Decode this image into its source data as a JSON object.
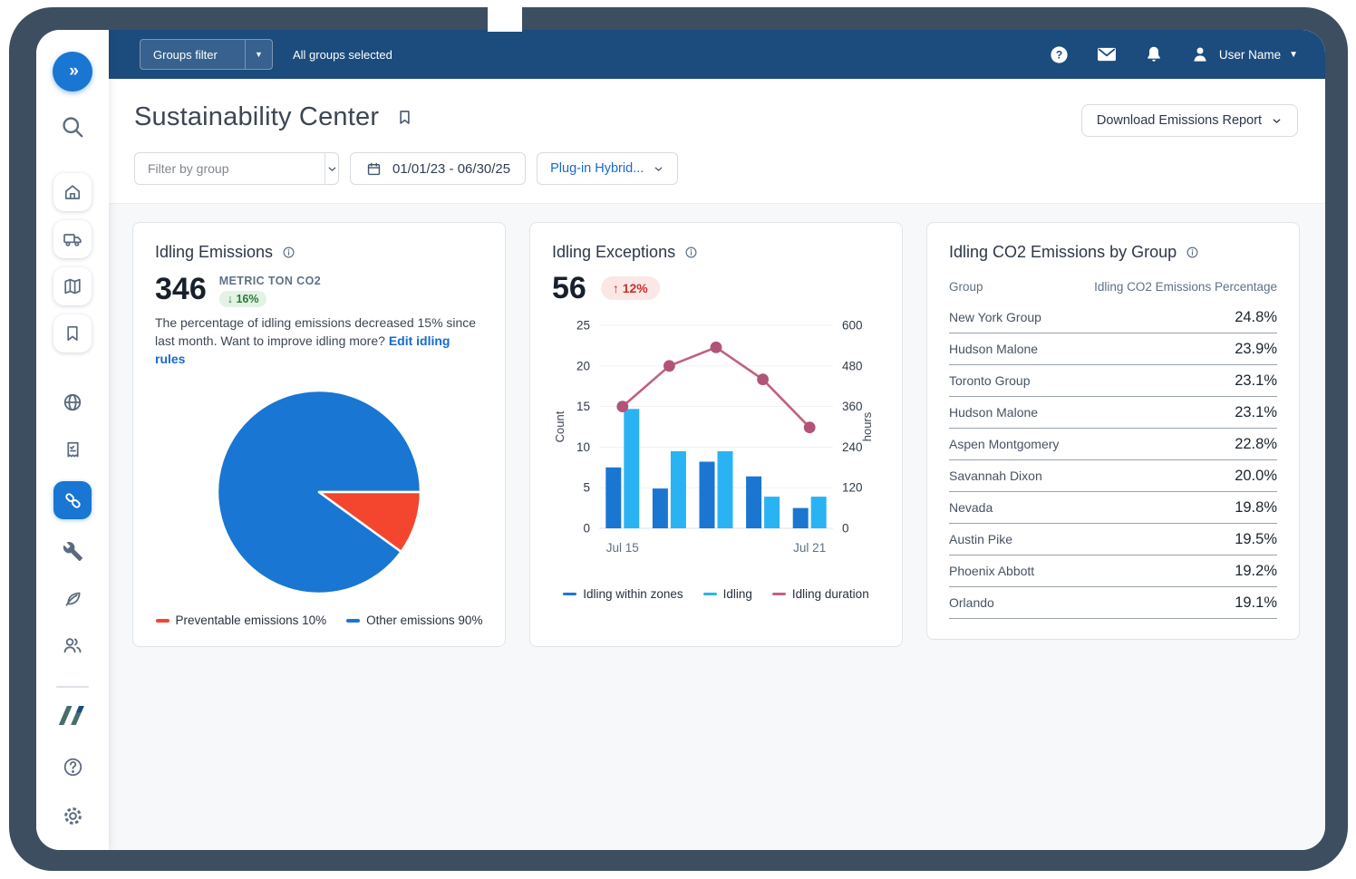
{
  "topbar": {
    "groups_filter_label": "Groups filter",
    "groups_status": "All groups selected",
    "user_name": "User Name"
  },
  "sidebar": {
    "icons": [
      "collapse-expand",
      "search",
      "home",
      "vehicles",
      "map",
      "bookmarks",
      "zones",
      "reports",
      "rules",
      "maintenance",
      "sustainability",
      "users",
      "brand-logo",
      "help",
      "settings"
    ],
    "active": "rules"
  },
  "header": {
    "title": "Sustainability Center",
    "download_button_label": "Download Emissions Report"
  },
  "filters": {
    "group_placeholder": "Filter by group",
    "date_range": "01/01/23 - 06/30/25",
    "vehicle_type": "Plug-in Hybrid..."
  },
  "cards": {
    "idling_emissions": {
      "title": "Idling Emissions",
      "value": "346",
      "unit": "METRIC TON CO2",
      "change": "↓ 16%",
      "description": "The percentage of idling emissions decreased 15% since last month. Want to improve idling more?",
      "link_label": "Edit idling rules",
      "legend": [
        {
          "label": "Preventable emissions 10%",
          "color": "#f4452e"
        },
        {
          "label": "Other emissions 90%",
          "color": "#1976d2"
        }
      ]
    },
    "idling_exceptions": {
      "title": "Idling Exceptions",
      "value": "56",
      "change": "↑ 12%",
      "legend": [
        {
          "label": "Idling within zones",
          "color": "#1b76d2"
        },
        {
          "label": "Idling",
          "color": "#2ab3f3"
        },
        {
          "label": "Idling duration",
          "color": "#c0617f"
        }
      ]
    },
    "groups_table": {
      "title": "Idling CO2 Emissions by Group",
      "columns": [
        "Group",
        "Idling CO2 Emissions Percentage"
      ],
      "rows": [
        {
          "group": "New York Group",
          "value": "24.8%"
        },
        {
          "group": "Hudson Malone",
          "value": "23.9%"
        },
        {
          "group": "Toronto Group",
          "value": "23.1%"
        },
        {
          "group": "Hudson Malone",
          "value": "23.1%"
        },
        {
          "group": "Aspen Montgomery",
          "value": "22.8%"
        },
        {
          "group": "Savannah Dixon",
          "value": "20.0%"
        },
        {
          "group": "Nevada",
          "value": "19.8%"
        },
        {
          "group": "Austin Pike",
          "value": "19.5%"
        },
        {
          "group": "Phoenix Abbott",
          "value": "19.2%"
        },
        {
          "group": "Orlando",
          "value": "19.1%"
        }
      ]
    }
  },
  "chart_data": [
    {
      "type": "pie",
      "title": "Idling Emissions",
      "slices": [
        {
          "label": "Preventable emissions",
          "value": 10,
          "color": "#f4452e"
        },
        {
          "label": "Other emissions",
          "value": 90,
          "color": "#1976d2"
        }
      ],
      "start_angle_deg": 0,
      "direction": "clockwise",
      "legend_position": "bottom"
    },
    {
      "type": "combo",
      "title": "Idling Exceptions",
      "categories": [
        "Jul 15",
        "",
        "",
        "",
        "Jul 21"
      ],
      "series": [
        {
          "name": "Idling within zones",
          "type": "bar",
          "axis": "left",
          "color": "#1b76d2",
          "values": [
            7.5,
            4.9,
            8.2,
            6.4,
            2.5
          ]
        },
        {
          "name": "Idling",
          "type": "bar",
          "axis": "left",
          "color": "#2ab3f3",
          "values": [
            14.7,
            9.5,
            9.5,
            3.9,
            3.9
          ]
        },
        {
          "name": "Idling duration",
          "type": "line",
          "axis": "right",
          "color": "#c0617f",
          "marker_color": "#b15478",
          "values": [
            360,
            480,
            535,
            440,
            298
          ]
        }
      ],
      "left_axis": {
        "label": "Count",
        "min": 0,
        "max": 25,
        "ticks": [
          0,
          5,
          10,
          15,
          20,
          25
        ]
      },
      "right_axis": {
        "label": "hours",
        "min": 0,
        "max": 600,
        "ticks": [
          0,
          120,
          240,
          360,
          480,
          600
        ]
      },
      "grid": true,
      "legend_position": "bottom"
    }
  ]
}
